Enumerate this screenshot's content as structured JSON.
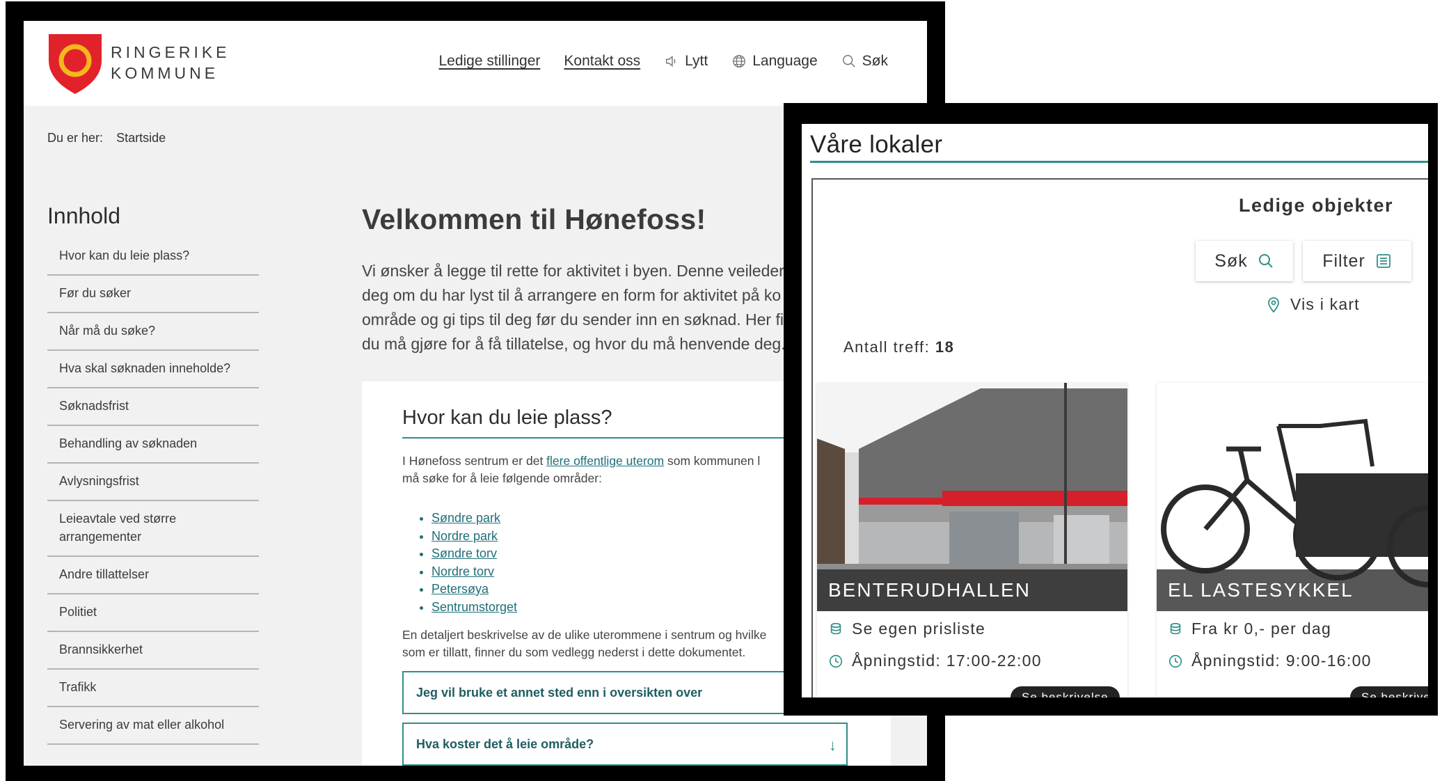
{
  "left_window": {
    "logo": {
      "line1": "RINGERIKE",
      "line2": "KOMMUNE"
    },
    "nav": {
      "jobs": "Ledige stillinger",
      "contact": "Kontakt oss",
      "listen": "Lytt",
      "language": "Language",
      "search": "Søk"
    },
    "breadcrumb": {
      "label": "Du er her:",
      "current": "Startside"
    },
    "toc": {
      "title": "Innhold",
      "items": [
        "Hvor kan du leie plass?",
        "Før du søker",
        "Når må du søke?",
        "Hva skal søknaden inneholde?",
        "Søknadsfrist",
        "Behandling av søknaden",
        "Avlysningsfrist",
        "Leieavtale ved større arrangementer",
        "Andre tillattelser",
        "Politiet",
        "Brannsikkerhet",
        "Trafikk",
        "Servering av mat eller alkohol"
      ]
    },
    "main": {
      "title": "Velkommen til Hønefoss!",
      "intro_lines": [
        "Vi ønsker å legge til rette for aktivitet i byen. Denne veileder",
        "deg om du har lyst til å arrangere en form for aktivitet på ko",
        "område og gi tips til deg før du sender inn en søknad. Her fi",
        "du må gjøre for å få tillatelse, og hvor du må henvende deg."
      ],
      "section": {
        "title": "Hvor kan du leie plass?",
        "p1_before": "I Hønefoss sentrum er det ",
        "p1_link": "flere offentlige uterom",
        "p1_after": " som kommunen l",
        "p1_line2": "må søke for å leie følgende områder:",
        "places": [
          "Søndre park",
          "Nordre park",
          "Søndre torv",
          "Nordre torv",
          "Petersøya",
          "Sentrumstorget"
        ],
        "p2_line1": "En detaljert beskrivelse av de ulike uterommene i sentrum og hvilke",
        "p2_line2": "som er tillatt, finner du som vedlegg nederst i dette dokumentet.",
        "accordion1": "Jeg vil bruke et annet sted enn i oversikten over",
        "accordion2": "Hva koster det å leie område?"
      }
    }
  },
  "right_window": {
    "title": "Våre lokaler",
    "heading": "Ledige objekter",
    "search_button": "Søk",
    "filter_button": "Filter",
    "map_link": "Vis i kart",
    "hits_label": "Antall treff:",
    "hits_count": "18",
    "objects": [
      {
        "name": "BENTERUDHALLEN",
        "price": "Se egen prisliste",
        "hours": "Åpningstid: 17:00-22:00",
        "button": "Se beskrivelse"
      },
      {
        "name": "EL LASTESYKKEL",
        "price": "Fra kr 0,- per dag",
        "hours": "Åpningstid: 9:00-16:00",
        "button": "Se beskrivel"
      }
    ]
  },
  "colors": {
    "accent": "#2e8f89",
    "logo_red": "#e2222b",
    "logo_yellow": "#f5b81b",
    "building_red": "#d3202a"
  }
}
